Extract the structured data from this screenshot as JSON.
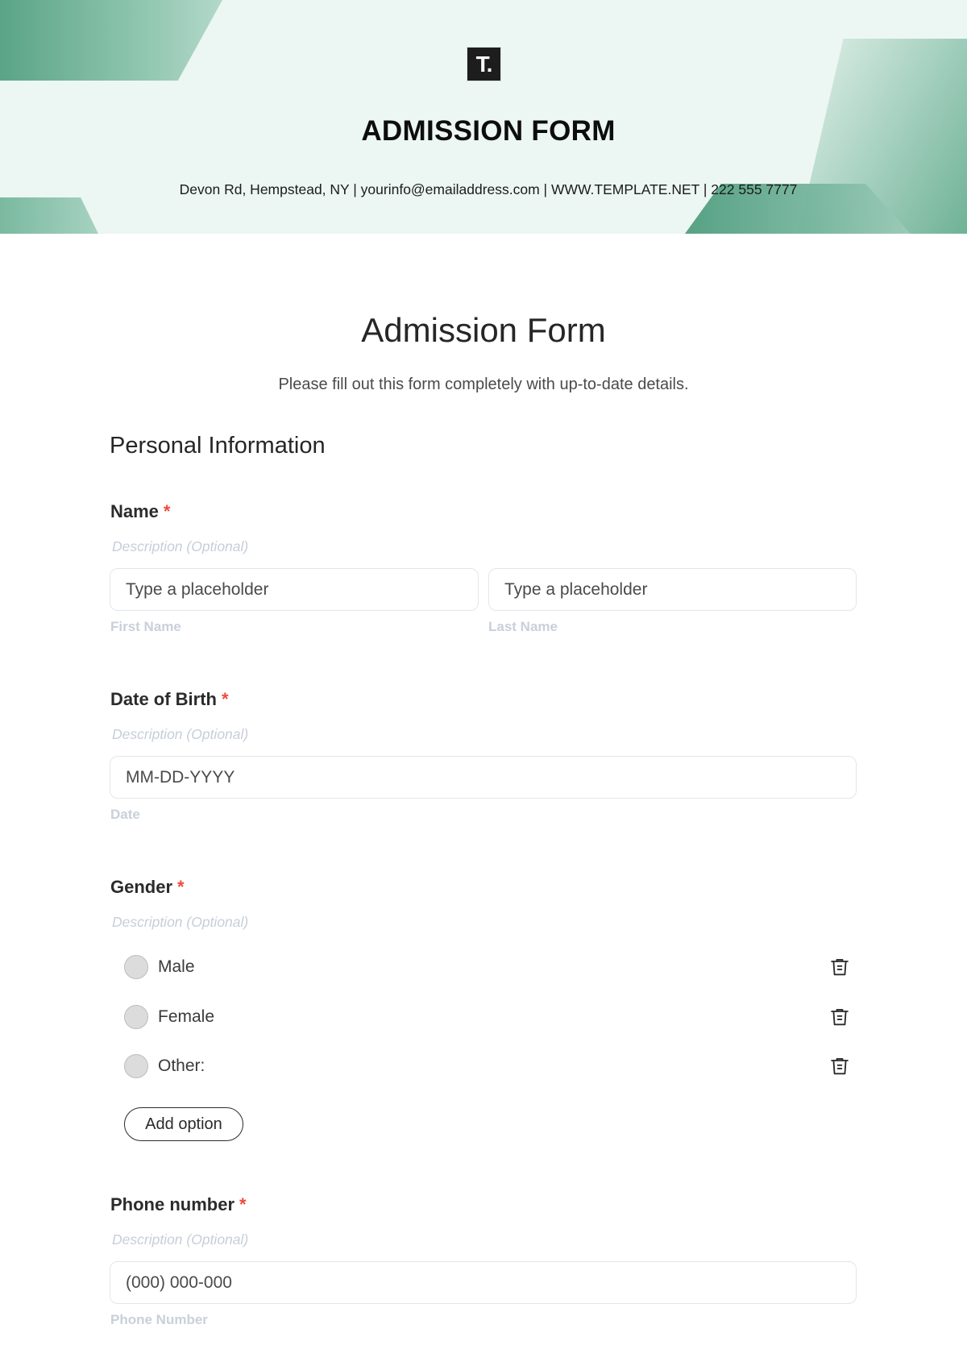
{
  "header": {
    "logo_text": "T.",
    "title": "ADMISSION FORM",
    "contact": "Devon Rd, Hempstead, NY | yourinfo@emailaddress.com | WWW.TEMPLATE.NET | 222 555 7777"
  },
  "colors": {
    "accent_green": "#5ba487",
    "banner_bg": "#ecf6f2",
    "required": "#ef4b3a"
  },
  "form": {
    "title": "Admission Form",
    "subtitle": "Please fill out this form completely with up-to-date details.",
    "section_title": "Personal Information",
    "required_marker": "*",
    "fields": {
      "name": {
        "label": "Name",
        "description": "Description (Optional)",
        "first": {
          "placeholder": "Type a placeholder",
          "sublabel": "First Name"
        },
        "last": {
          "placeholder": "Type a placeholder",
          "sublabel": "Last Name"
        }
      },
      "dob": {
        "label": "Date of Birth",
        "description": "Description (Optional)",
        "placeholder": "MM-DD-YYYY",
        "sublabel": "Date"
      },
      "gender": {
        "label": "Gender",
        "description": "Description (Optional)",
        "options": [
          {
            "label": "Male",
            "icon": "trash-icon"
          },
          {
            "label": "Female",
            "icon": "trash-icon"
          },
          {
            "label": "Other:",
            "icon": "trash-icon"
          }
        ],
        "add_option_label": "Add option"
      },
      "phone": {
        "label": "Phone number",
        "description": "Description (Optional)",
        "placeholder": "(000) 000-000",
        "sublabel": "Phone Number"
      }
    }
  }
}
